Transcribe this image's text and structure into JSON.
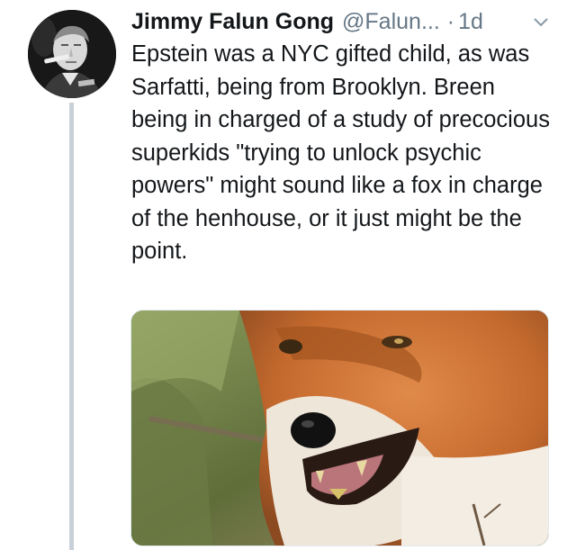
{
  "tweet": {
    "author": {
      "display_name": "Jimmy Falun Gong",
      "handle": "@Falun...",
      "avatar_icon": "profile-photo-smoking-man"
    },
    "separator": "·",
    "timestamp": "1d",
    "menu_icon": "chevron-down-icon",
    "text": "Epstein was a NYC gifted child, as was Sarfatti, being from Brooklyn. Breen being in charged of a study of precocious superkids \"trying to unlock psychic powers\" might sound like a fox in charge of the henhouse, or it just might be the point.",
    "media": {
      "type": "photo",
      "subject": "snarling red fox"
    }
  },
  "colors": {
    "name": "#14171a",
    "secondary": "#657786",
    "thread_line": "#c8d0d8"
  }
}
